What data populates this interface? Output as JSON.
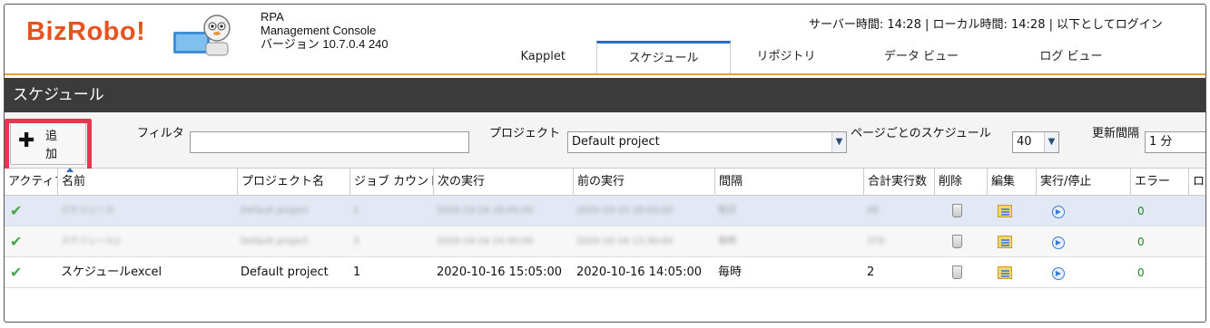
{
  "header": {
    "logo": "BizRobo!",
    "product_line1": "RPA",
    "product_line2": "Management Console",
    "version": "バージョン 10.7.0.4 240",
    "server_time": "サーバー時間: 14:28 | ローカル時間: 14:28 | 以下としてログイン"
  },
  "tabs": [
    {
      "label": "Kapplet",
      "active": false
    },
    {
      "label": "スケジュール",
      "active": true
    },
    {
      "label": "リポジトリ",
      "active": false
    },
    {
      "label": "データ ビュー",
      "active": false
    },
    {
      "label": "ログ ビュー",
      "active": false
    }
  ],
  "page_title": "スケジュール",
  "toolbar": {
    "add_label": "追加",
    "filter_label": "フィルタ",
    "filter_value": "",
    "project_label": "プロジェクト",
    "project_value": "Default project",
    "per_page_label": "ページごとのスケジュール",
    "per_page_value": "40",
    "refresh_label": "更新間隔",
    "refresh_value": "1 分"
  },
  "columns": [
    "アクティブ",
    "名前",
    "プロジェクト名",
    "ジョブ カウント",
    "次の実行",
    "前の実行",
    "間隔",
    "合計実行数",
    "削除",
    "編集",
    "実行/停止",
    "エラー",
    "ロ"
  ],
  "rows": [
    {
      "active": "✔",
      "name": "スケジュール",
      "project": "Default project",
      "job_count": "1",
      "next": "2020-10-16 18:00:00",
      "prev": "2020-10-15 18:00:00",
      "interval": "毎日",
      "total": "48",
      "errors": "0",
      "blurred": true
    },
    {
      "active": "✔",
      "name": "スケジュール2",
      "project": "Default project",
      "job_count": "3",
      "next": "2020-10-16 14:30:00",
      "prev": "2020-10-16 13:30:00",
      "interval": "毎時",
      "total": "379",
      "errors": "0",
      "blurred": true
    },
    {
      "active": "✔",
      "name": "スケジュールexcel",
      "project": "Default project",
      "job_count": "1",
      "next": "2020-10-16 15:05:00",
      "prev": "2020-10-16 14:05:00",
      "interval": "毎時",
      "total": "2",
      "errors": "0",
      "blurred": false
    }
  ],
  "colors": {
    "accent": "#2a6ebb",
    "logo": "#e8521f",
    "highlight": "#e5374f",
    "titlebar": "#3b3b3b"
  }
}
